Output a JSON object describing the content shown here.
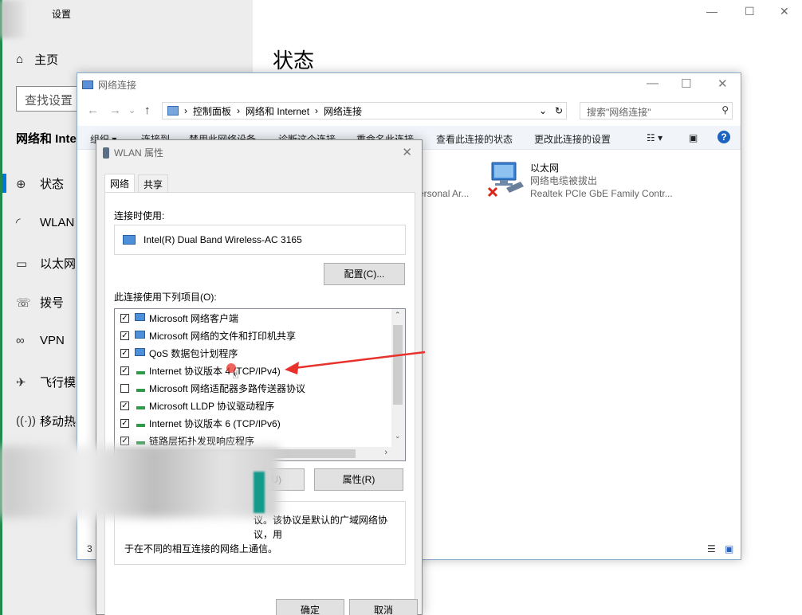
{
  "settings": {
    "title": "设置",
    "home": "主页",
    "search_placeholder": "查找设置",
    "section": "网络和 Inter",
    "nav": [
      "状态",
      "WLAN",
      "以太网",
      "拨号",
      "VPN",
      "飞行模",
      "移动热"
    ],
    "right_title": "状态"
  },
  "netwin": {
    "title": "网络连接",
    "breadcrumb": [
      "控制面板",
      "网络和 Internet",
      "网络连接"
    ],
    "search_placeholder": "搜索\"网络连接\"",
    "toolbar": [
      "组织 ▾",
      "连接到",
      "禁用此网络设备",
      "诊断这个连接",
      "重命名此连接",
      "查看此连接的状态",
      "更改此连接的设置"
    ],
    "adapter": {
      "name": "以太网",
      "status": "网络电缆被拔出",
      "device": "Realtek PCIe GbE Family Contr..."
    },
    "partial_adapter": "ersonal Ar...",
    "count": "3"
  },
  "dialog": {
    "title": "WLAN 属性",
    "tabs": [
      "网络",
      "共享"
    ],
    "connect_using_label": "连接时使用:",
    "adapter_name": "Intel(R) Dual Band Wireless-AC 3165",
    "configure_button": "配置(C)...",
    "items_label": "此连接使用下列项目(O):",
    "items": [
      {
        "label": "Microsoft 网络客户端",
        "checked": true
      },
      {
        "label": "Microsoft 网络的文件和打印机共享",
        "checked": true
      },
      {
        "label": "QoS 数据包计划程序",
        "checked": true
      },
      {
        "label": "Internet 协议版本 4 (TCP/IPv4)",
        "checked": true
      },
      {
        "label": "Microsoft 网络适配器多路传送器协议",
        "checked": false
      },
      {
        "label": "Microsoft LLDP 协议驱动程序",
        "checked": true
      },
      {
        "label": "Internet 协议版本 6 (TCP/IPv6)",
        "checked": true
      },
      {
        "label": "链路层拓扑发现响应程序",
        "checked": true
      }
    ],
    "uninstall_button": "U)",
    "properties_button": "属性(R)",
    "description_line1": "议。该协议是默认的广域网络协议，用",
    "description_line2": "于在不同的相互连接的网络上通信。",
    "ok_button": "确定",
    "cancel_button": "取消"
  },
  "colors": {
    "accent": "#0078d7",
    "annotation_arrow": "#e8312a",
    "edge_green": "#1f8a4c"
  }
}
